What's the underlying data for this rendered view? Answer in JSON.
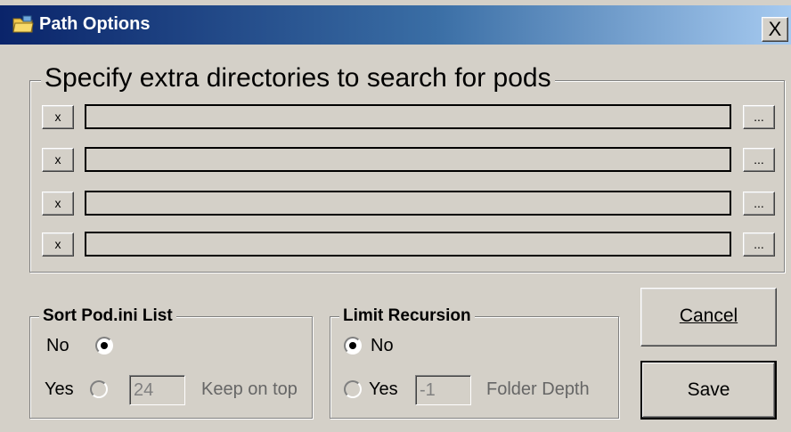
{
  "window": {
    "title": "Path Options",
    "close_label": "X"
  },
  "extra_dirs": {
    "legend": "Specify extra directories to search for pods",
    "rows": [
      {
        "remove_label": "x",
        "path_value": "",
        "browse_label": "..."
      },
      {
        "remove_label": "x",
        "path_value": "",
        "browse_label": "..."
      },
      {
        "remove_label": "x",
        "path_value": "",
        "browse_label": "..."
      },
      {
        "remove_label": "x",
        "path_value": "",
        "browse_label": "..."
      }
    ]
  },
  "sort_group": {
    "legend": "Sort Pod.ini List",
    "no_label": "No",
    "no_selected": true,
    "yes_label": "Yes",
    "keep_value": "24",
    "keep_label": "Keep on top"
  },
  "recursion_group": {
    "legend": "Limit Recursion",
    "no_label": "No",
    "no_selected": true,
    "yes_label": "Yes",
    "depth_value": "-1",
    "depth_label": "Folder Depth"
  },
  "buttons": {
    "cancel_label": "Cancel",
    "save_label": "Save"
  },
  "colors": {
    "face": "#d4d0c8",
    "title_start": "#0a246a",
    "title_end": "#a6caf0"
  }
}
